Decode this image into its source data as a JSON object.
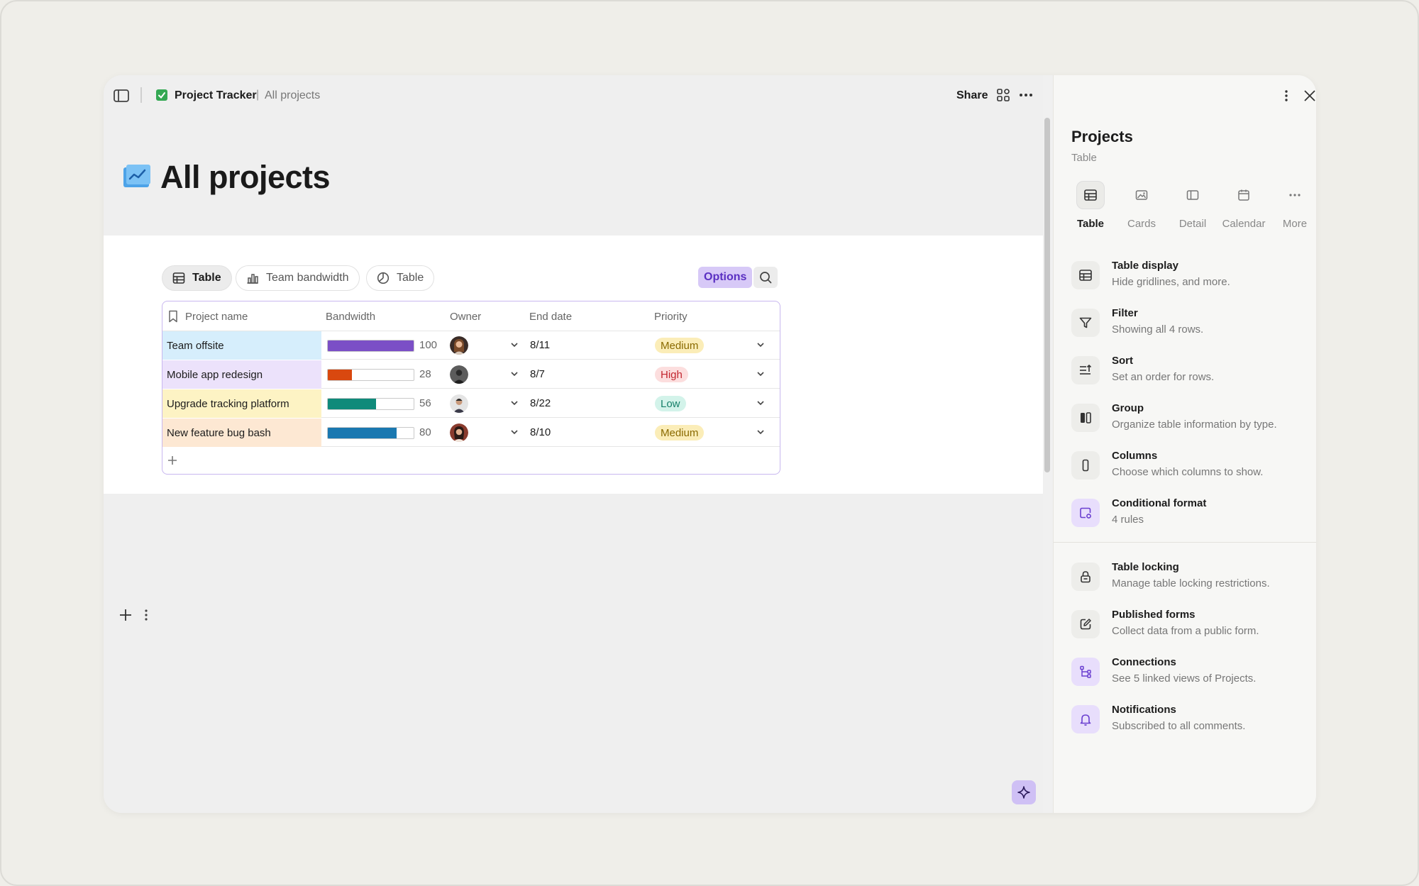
{
  "breadcrumb": {
    "doc": "Project Tracker",
    "separator": "|",
    "page": "All projects"
  },
  "header": {
    "share_label": "Share"
  },
  "page_title": "All projects",
  "view_tabs": [
    {
      "label": "Table",
      "icon": "table-icon",
      "active": true
    },
    {
      "label": "Team bandwidth",
      "icon": "bar-chart-icon",
      "active": false
    },
    {
      "label": "Table",
      "icon": "pie-chart-icon",
      "active": false
    }
  ],
  "toolbar": {
    "options_label": "Options"
  },
  "table": {
    "columns": [
      "Project name",
      "Bandwidth",
      "Owner",
      "End date",
      "Priority"
    ],
    "rows": [
      {
        "name": "Team offsite",
        "row_color": "#d6eefc",
        "bandwidth": 100,
        "bar_color": "#7b4fc6",
        "end_date": "8/11",
        "priority": "Medium",
        "priority_bg": "#fbedb8",
        "priority_fg": "#8a6a00"
      },
      {
        "name": "Mobile app redesign",
        "row_color": "#ece2fb",
        "bandwidth": 28,
        "bar_color": "#d9480f",
        "end_date": "8/7",
        "priority": "High",
        "priority_bg": "#fcdede",
        "priority_fg": "#c2262f"
      },
      {
        "name": "Upgrade tracking platform",
        "row_color": "#fdf3c4",
        "bandwidth": 56,
        "bar_color": "#0f8a7a",
        "end_date": "8/22",
        "priority": "Low",
        "priority_bg": "#d3f3ea",
        "priority_fg": "#17806a"
      },
      {
        "name": "New feature bug bash",
        "row_color": "#fde8d3",
        "bandwidth": 80,
        "bar_color": "#1a78b0",
        "end_date": "8/10",
        "priority": "Medium",
        "priority_bg": "#fbedb8",
        "priority_fg": "#8a6a00"
      }
    ]
  },
  "panel": {
    "title": "Projects",
    "subtitle": "Table",
    "layouts": [
      {
        "label": "Table",
        "icon": "table-icon",
        "active": true
      },
      {
        "label": "Cards",
        "icon": "image-icon",
        "active": false
      },
      {
        "label": "Detail",
        "icon": "sidebar-icon",
        "active": false
      },
      {
        "label": "Calendar",
        "icon": "calendar-icon",
        "active": false
      },
      {
        "label": "More",
        "icon": "ellipsis-icon",
        "active": false
      }
    ],
    "settings": [
      {
        "title": "Table display",
        "desc": "Hide gridlines, and more.",
        "icon": "table-icon"
      },
      {
        "title": "Filter",
        "desc": "Showing all 4 rows.",
        "icon": "filter-icon"
      },
      {
        "title": "Sort",
        "desc": "Set an order for rows.",
        "icon": "sort-icon"
      },
      {
        "title": "Group",
        "desc": "Organize table information by type.",
        "icon": "group-icon"
      },
      {
        "title": "Columns",
        "desc": "Choose which columns to show.",
        "icon": "column-icon"
      },
      {
        "title": "Conditional format",
        "desc": "4 rules",
        "icon": "conditional-format-icon"
      },
      {
        "title": "Table locking",
        "desc": "Manage table locking restrictions.",
        "icon": "lock-icon"
      },
      {
        "title": "Published forms",
        "desc": "Collect data from a public form.",
        "icon": "form-edit-icon"
      },
      {
        "title": "Connections",
        "desc": "See 5 linked views of Projects.",
        "icon": "connections-icon"
      },
      {
        "title": "Notifications",
        "desc": "Subscribed to all comments.",
        "icon": "bell-icon"
      }
    ]
  },
  "colors": {
    "accent": "#5a2fc2",
    "accent_light": "#d7c9f7",
    "table_border": "#c8b7ef"
  }
}
